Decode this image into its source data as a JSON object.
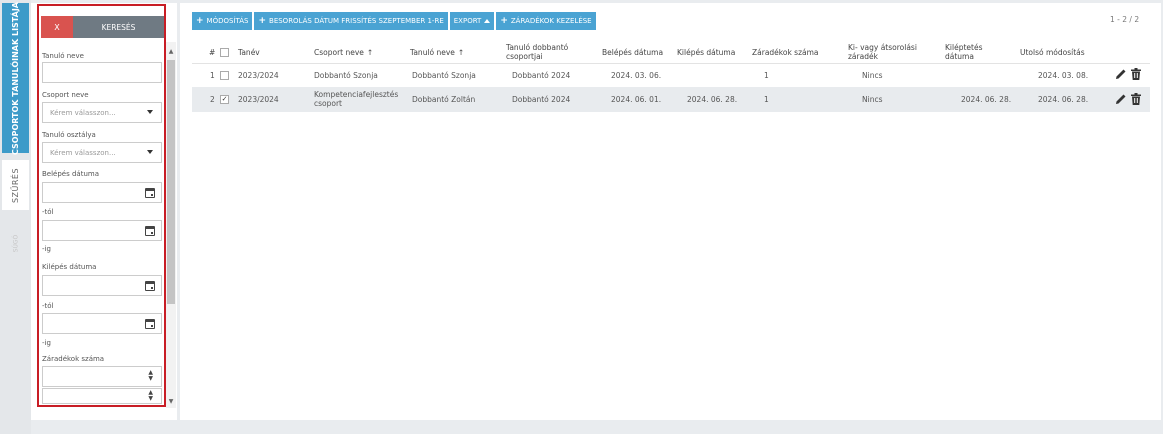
{
  "vtabs": {
    "active": "CSOPORTOK TANULÓINAK LISTÁJA",
    "filter": "SZŰRÉS",
    "help": "SÚGÓ"
  },
  "filter": {
    "clear_label": "X",
    "search_label": "KERESÉS",
    "student_name_label": "Tanuló neve",
    "student_name_value": "",
    "group_name_label": "Csoport neve",
    "group_name_placeholder": "Kérem válasszon...",
    "student_class_label": "Tanuló osztálya",
    "student_class_placeholder": "Kérem válasszon...",
    "entry_date_label": "Belépés dátuma",
    "entry_from_suffix": "-tól",
    "entry_to_suffix": "-ig",
    "exit_date_label": "Kilépés dátuma",
    "exit_from_suffix": "-tól",
    "exit_to_suffix": "-ig",
    "clauses_count_label": "Záradékok száma",
    "icons": {
      "calendar": "calendar-icon",
      "spinner": "spinner-arrows-icon",
      "dropdown": "chevron-down-icon"
    }
  },
  "toolbar": {
    "modify_label": "MÓDOSÍTÁS",
    "refresh_label": "BESOROLÁS DÁTUM FRISSÍTÉS SZEPTEMBER 1-RE",
    "export_label": "EXPORT",
    "clauses_label": "ZÁRADÉKOK KEZELÉSE",
    "accent_color": "#4aa3d3"
  },
  "pager": {
    "text": "1 - 2 / 2"
  },
  "table": {
    "headers": {
      "index": "#",
      "year": "Tanév",
      "group": "Csoport neve",
      "student": "Tanuló neve",
      "student_groups": "Tanuló dobbantó csoportjai",
      "entry": "Belépés dátuma",
      "exit": "Kilépés dátuma",
      "clauses": "Záradékok száma",
      "transfer_clause": "Ki- vagy átsorolási záradék",
      "leave_date": "Kiléptetés dátuma",
      "last_modified": "Utolsó módosítás"
    },
    "rows": [
      {
        "index": "1",
        "checked": "",
        "year": "2023/2024",
        "group": "Dobbantó Szonja",
        "student": "Dobbantó Szonja",
        "student_groups": "Dobbantó 2024",
        "entry": "2024. 03. 06.",
        "exit": "",
        "clauses": "1",
        "transfer_clause": "Nincs",
        "leave_date": "",
        "last_modified": "2024. 03. 08."
      },
      {
        "index": "2",
        "checked": "✓",
        "year": "2023/2024",
        "group": "Kompetenciafejlesztés csoport",
        "student": "Dobbantó Zoltán",
        "student_groups": "Dobbantó 2024",
        "entry": "2024. 06. 01.",
        "exit": "2024. 06. 28.",
        "clauses": "1",
        "transfer_clause": "Nincs",
        "leave_date": "2024. 06. 28.",
        "last_modified": "2024. 06. 28."
      }
    ]
  },
  "colors": {
    "tab_active": "#3d9bc9",
    "clear_button": "#d9534f",
    "search_button": "#6f7a83",
    "highlight_frame": "#c81d25",
    "selected_row": "#e8ebee"
  }
}
